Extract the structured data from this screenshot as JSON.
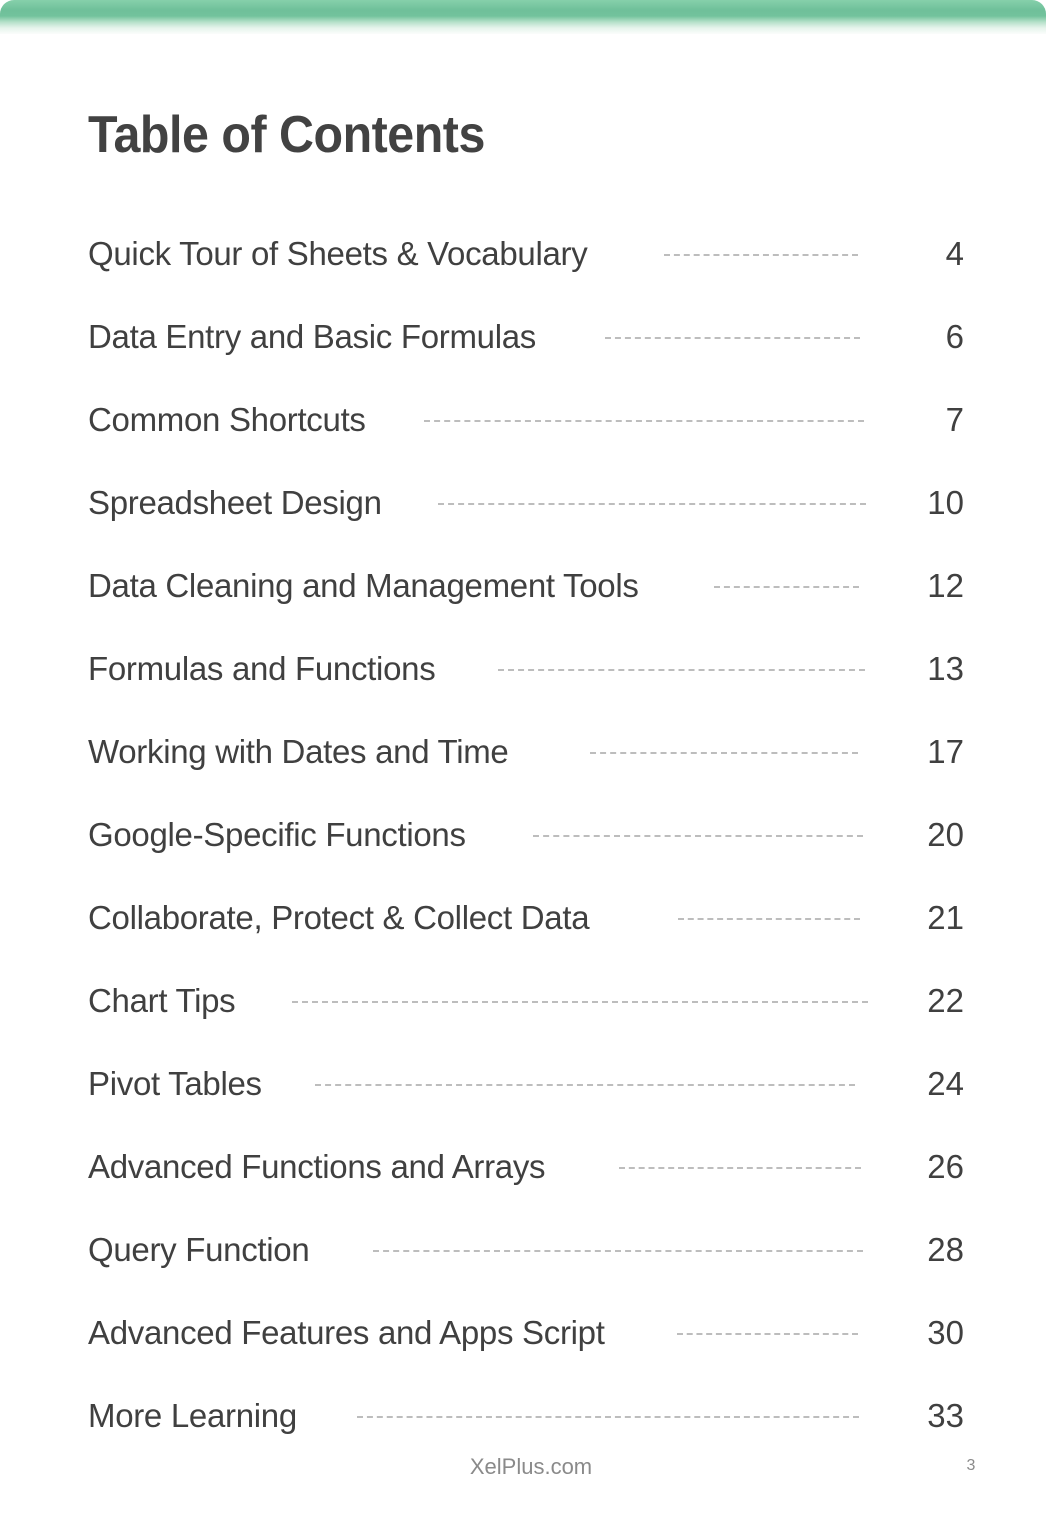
{
  "header": {
    "accent_color": "#6fc09a"
  },
  "title": "Table of Contents",
  "toc": {
    "entries": [
      {
        "title": "Quick Tour of Sheets & Vocabulary",
        "page": "4"
      },
      {
        "title": "Data Entry and Basic Formulas",
        "page": "6"
      },
      {
        "title": "Common Shortcuts",
        "page": "7"
      },
      {
        "title": "Spreadsheet Design",
        "page": "10"
      },
      {
        "title": "Data Cleaning and Management Tools",
        "page": "12"
      },
      {
        "title": "Formulas and Functions",
        "page": "13"
      },
      {
        "title": "Working with Dates and Time",
        "page": "17"
      },
      {
        "title": "Google-Specific Functions",
        "page": "20"
      },
      {
        "title": "Collaborate, Protect & Collect Data",
        "page": "21"
      },
      {
        "title": "Chart Tips",
        "page": "22"
      },
      {
        "title": "Pivot Tables",
        "page": "24"
      },
      {
        "title": "Advanced Functions and Arrays",
        "page": "26"
      },
      {
        "title": "Query Function",
        "page": "28"
      },
      {
        "title": "Advanced Features and Apps Script",
        "page": "30"
      },
      {
        "title": "More Learning",
        "page": "33"
      }
    ]
  },
  "footer": {
    "site": "XelPlus.com",
    "page_number": "3"
  }
}
